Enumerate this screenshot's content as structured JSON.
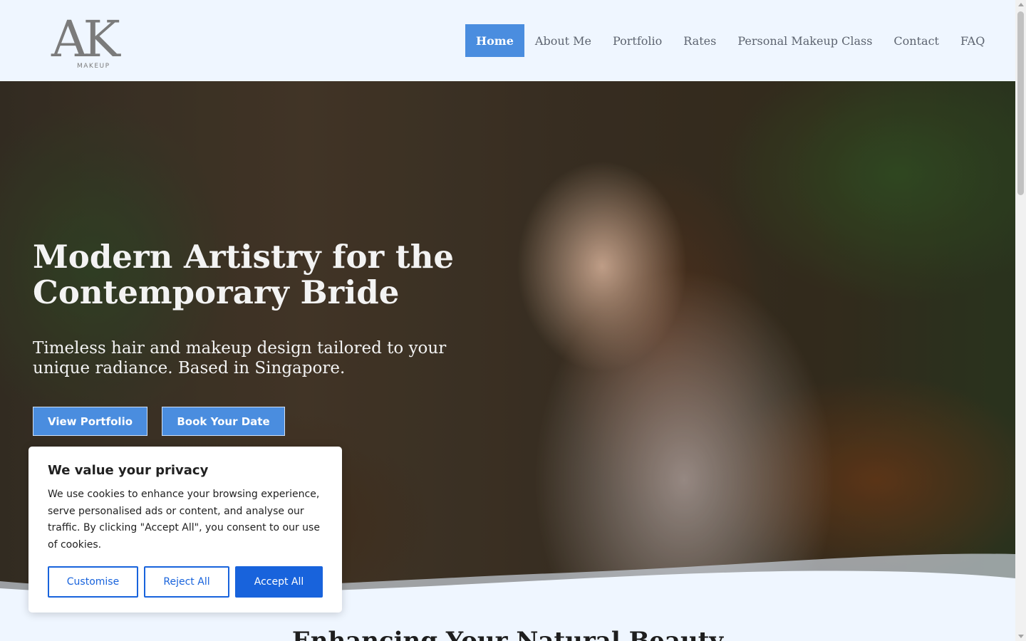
{
  "brand": {
    "logo_mark": "AK",
    "logo_sub": "MAKEUP"
  },
  "nav": {
    "items": [
      {
        "label": "Home",
        "active": true
      },
      {
        "label": "About Me"
      },
      {
        "label": "Portfolio"
      },
      {
        "label": "Rates"
      },
      {
        "label": "Personal Makeup Class"
      },
      {
        "label": "Contact"
      },
      {
        "label": "FAQ"
      }
    ]
  },
  "hero": {
    "title": "Modern Artistry for the Contemporary Bride",
    "subtitle": "Timeless hair and makeup design tailored to your unique radiance. Based in Singapore.",
    "btn_portfolio": "View Portfolio",
    "btn_book": "Book Your Date"
  },
  "next_section": {
    "title": "Enhancing Your Natural Beauty"
  },
  "cookie": {
    "title": "We value your privacy",
    "text": "We use cookies to enhance your browsing experience, serve personalised ads or content, and analyse our traffic. By clicking \"Accept All\", you consent to our use of cookies.",
    "customise": "Customise",
    "reject": "Reject All",
    "accept": "Accept All"
  },
  "colors": {
    "accent": "#4a8ddf",
    "cookie_accent": "#1863dc",
    "page_bg": "#eff6ff"
  }
}
